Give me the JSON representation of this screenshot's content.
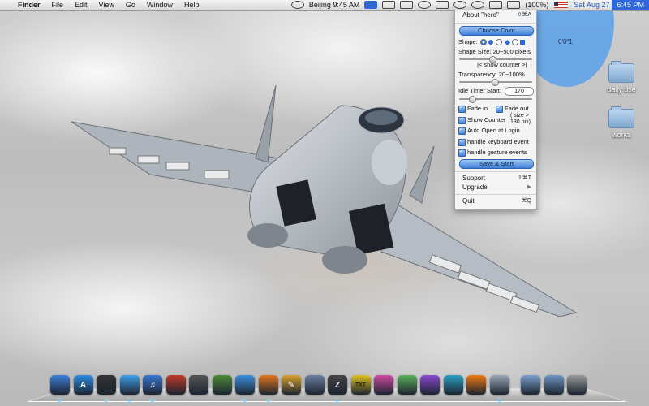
{
  "menubar": {
    "apple": "",
    "app": "Finder",
    "items": [
      "File",
      "Edit",
      "View",
      "Go",
      "Window",
      "Help"
    ],
    "location": "Beijing 9:45 AM",
    "battery": "(100%)",
    "date": "Sat Aug 27",
    "time": "6:45 PM"
  },
  "desktop": {
    "circle_label": "0'0\"1",
    "folders": [
      "daily use",
      "works"
    ]
  },
  "panel": {
    "about": "About \"here\"",
    "about_shortcut": "⇧⌘A",
    "choose_color": "Choose Color",
    "shape_label": "Shape:",
    "shape_size_label": "Shape Size: 20~500 pixels",
    "show_counter_toggle": "|< show counter >|",
    "transparency_label": "Transparency: 20~100%",
    "idle_timer_label": "Idle Timer Start:",
    "idle_timer_value": "170",
    "fade_in": "Fade in",
    "fade_out": "Fade out",
    "show_counter": "Show Counter",
    "counter_hint_1": "( size >",
    "counter_hint_2": "130 pix)",
    "auto_open": "Auto Open at Login",
    "keyboard": "handle keyboard event",
    "gesture": "handle gesture events",
    "save_start": "Save & Start",
    "support": "Support",
    "support_shortcut": "⇧⌘T",
    "upgrade": "Upgrade",
    "upgrade_arrow": "▶",
    "quit": "Quit",
    "quit_shortcut": "⌘Q",
    "shape_size_level": 0.45,
    "transparency_level": 0.48,
    "idle_timer_level": 0.15
  },
  "dock": {
    "icons": [
      {
        "name": "finder-icon",
        "glyph": "",
        "color": "#3d7ed8"
      },
      {
        "name": "app-store-icon",
        "glyph": "A",
        "color": "#2d8be0"
      },
      {
        "name": "dashboard-icon",
        "glyph": "",
        "color": "#333333"
      },
      {
        "name": "people-icon",
        "glyph": "",
        "color": "#3fa0e8"
      },
      {
        "name": "itunes-icon",
        "glyph": "♫",
        "color": "#3a78d0"
      },
      {
        "name": "activity-icon",
        "glyph": "",
        "color": "#c23a2a"
      },
      {
        "name": "preview-icon",
        "glyph": "",
        "color": "#555555"
      },
      {
        "name": "chart-icon",
        "glyph": "",
        "color": "#4d8a3a"
      },
      {
        "name": "safari-icon",
        "glyph": "",
        "color": "#3b8fdc"
      },
      {
        "name": "firefox-icon",
        "glyph": "",
        "color": "#e3741d"
      },
      {
        "name": "pencil-icon",
        "glyph": "✎",
        "color": "#d9a12e"
      },
      {
        "name": "xcode-icon",
        "glyph": "",
        "color": "#6a7fa0"
      },
      {
        "name": "z-icon",
        "glyph": "Z",
        "color": "#444444"
      },
      {
        "name": "txt-icon",
        "glyph": "TXT",
        "color": "#e0c020"
      },
      {
        "name": "ring-icon",
        "glyph": "",
        "color": "#d04aa0"
      },
      {
        "name": "chain-icon",
        "glyph": "",
        "color": "#5ab05a"
      },
      {
        "name": "tools-icon",
        "glyph": "",
        "color": "#8a4ad0"
      },
      {
        "name": "network-icon",
        "glyph": "",
        "color": "#2aa0c0"
      },
      {
        "name": "orange-ball-icon",
        "glyph": "",
        "color": "#f07a10"
      },
      {
        "name": "here-icon",
        "glyph": "",
        "color": "#9aa6b8"
      },
      {
        "name": "applications-folder-icon",
        "glyph": "",
        "color": "#7aa0cc"
      },
      {
        "name": "downloads-folder-icon",
        "glyph": "",
        "color": "#6f95c4"
      },
      {
        "name": "trash-icon",
        "glyph": "",
        "color": "#9a9a9a"
      }
    ]
  }
}
